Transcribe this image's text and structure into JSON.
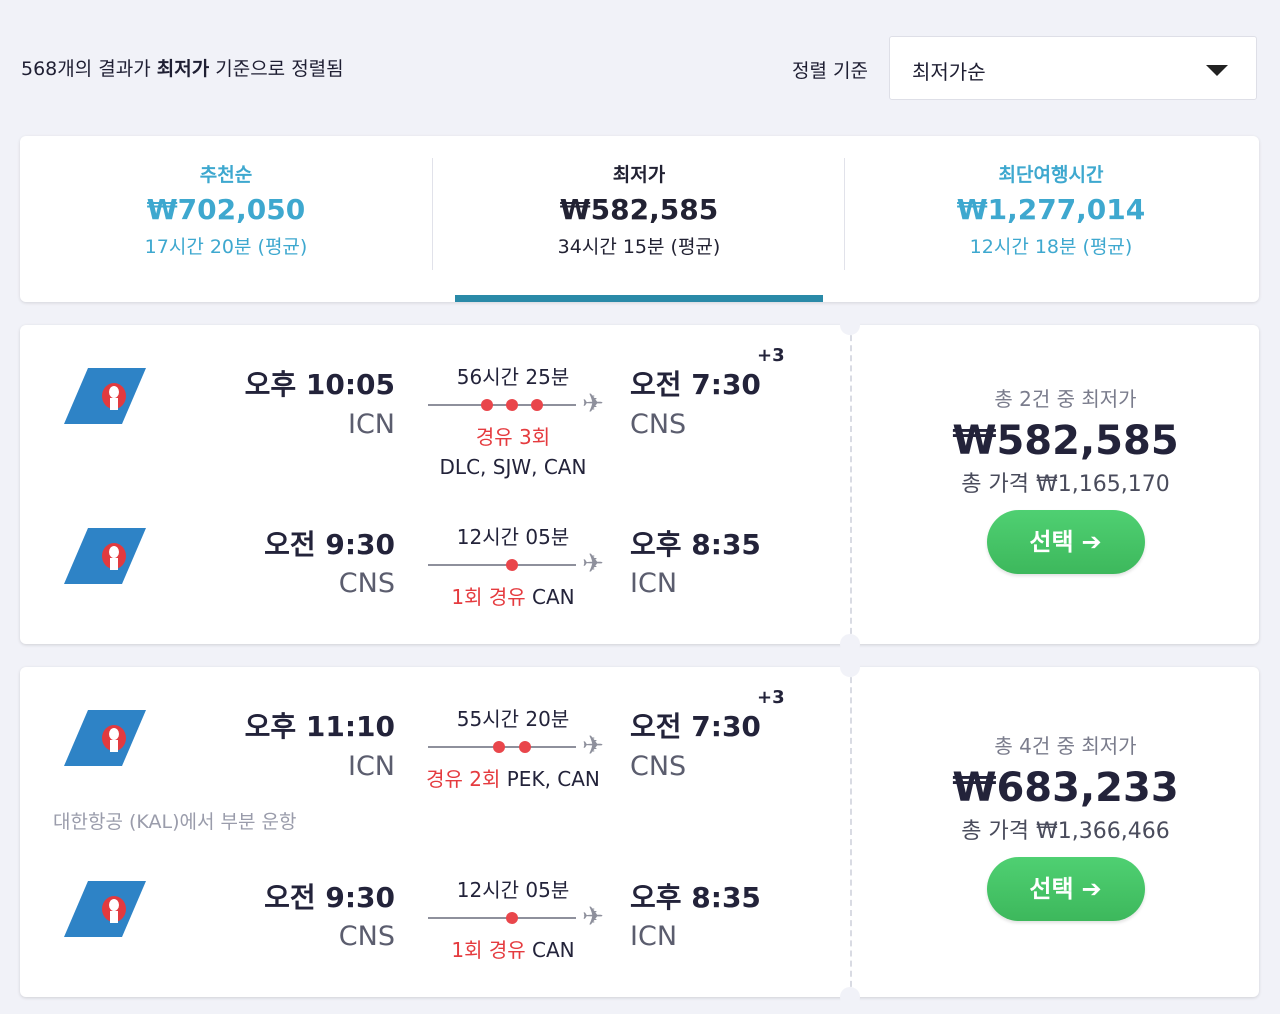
{
  "summary": {
    "count_prefix": "568개의 결과가 ",
    "sort_bold": "최저가",
    "suffix": " 기준으로 정렬됨"
  },
  "sort": {
    "label": "정렬 기준",
    "selected": "최저가순"
  },
  "tabs": [
    {
      "title": "추천순",
      "price": "₩702,050",
      "duration": "17시간 20분 (평균)"
    },
    {
      "title": "최저가",
      "price": "₩582,585",
      "duration": "34시간 15분 (평균)"
    },
    {
      "title": "최단여행시간",
      "price": "₩1,277,014",
      "duration": "12시간 18분 (평균)"
    }
  ],
  "results": [
    {
      "outbound": {
        "dep_time": "오후 10:05",
        "dep_code": "ICN",
        "duration": "56시간 25분",
        "arr_time": "오전 7:30",
        "arr_code": "CNS",
        "day_offset": "+3",
        "stops_label": "경유 3회",
        "via": "DLC, SJW, CAN"
      },
      "inbound": {
        "dep_time": "오전 9:30",
        "dep_code": "CNS",
        "duration": "12시간 05분",
        "arr_time": "오후 8:35",
        "arr_code": "ICN",
        "stops_label": "1회 경유",
        "via": "CAN"
      },
      "price": {
        "count": "총 2건 중 최저가",
        "amount": "₩582,585",
        "total": "총 가격 ₩1,165,170",
        "button": "선택"
      }
    },
    {
      "outbound": {
        "dep_time": "오후 11:10",
        "dep_code": "ICN",
        "duration": "55시간 20분",
        "arr_time": "오전 7:30",
        "arr_code": "CNS",
        "day_offset": "+3",
        "stops_label": "경유 2회",
        "via": "PEK, CAN"
      },
      "operated_by": "대한항공 (KAL)에서 부분 운항",
      "inbound": {
        "dep_time": "오전 9:30",
        "dep_code": "CNS",
        "duration": "12시간 05분",
        "arr_time": "오후 8:35",
        "arr_code": "ICN",
        "stops_label": "1회 경유",
        "via": "CAN"
      },
      "price": {
        "count": "총 4건 중 최저가",
        "amount": "₩683,233",
        "total": "총 가격 ₩1,366,466",
        "button": "선택"
      }
    }
  ],
  "colors": {
    "accent_blue": "#3ea8cf",
    "tab_underline": "#2a8aa8",
    "stop_red": "#e53b3f",
    "button_green": "#44c464"
  },
  "icons": {
    "airline_logo": "china-southern-airline-logo-icon",
    "plane": "plane-icon",
    "caret": "chevron-down-icon",
    "arrow": "arrow-right-icon"
  }
}
